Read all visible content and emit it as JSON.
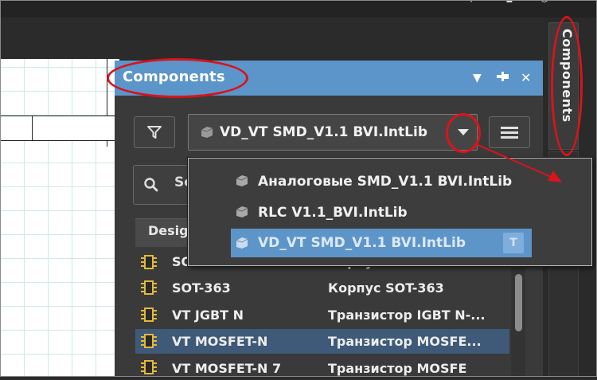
{
  "panel": {
    "title": "Components",
    "side_tab_label": "Components"
  },
  "library_select": {
    "value": "VD_VT SMD_V1.1 BVI.IntLib"
  },
  "search": {
    "value": "Se"
  },
  "table": {
    "header_design": "Desig",
    "rows": [
      {
        "name": "SOT-",
        "desc": "Корпус SOT-",
        "selected": false
      },
      {
        "name": "SOT-363",
        "desc": "Корпус SOT-363",
        "selected": false
      },
      {
        "name": "VT JGBT N",
        "desc": "Транзистор IGBT N-...",
        "selected": false
      },
      {
        "name": "VT MOSFET-N",
        "desc": "Транзистор MOSFE...",
        "selected": true
      },
      {
        "name": "VT MOSFET-N 7",
        "desc": "Транзистор MOSFE",
        "selected": false
      }
    ]
  },
  "dropdown": {
    "items": [
      {
        "label": "Аналоговые SMD_V1.1 BVI.IntLib",
        "selected": false
      },
      {
        "label": "RLC V1.1_BVI.IntLib",
        "selected": false
      },
      {
        "label": "VD_VT SMD_V1.1 BVI.IntLib",
        "selected": true
      }
    ],
    "selected_badge": "T"
  },
  "colors": {
    "accent": "#5c95c9",
    "annotation": "#d8141c",
    "selected_row": "#3f5a78"
  }
}
